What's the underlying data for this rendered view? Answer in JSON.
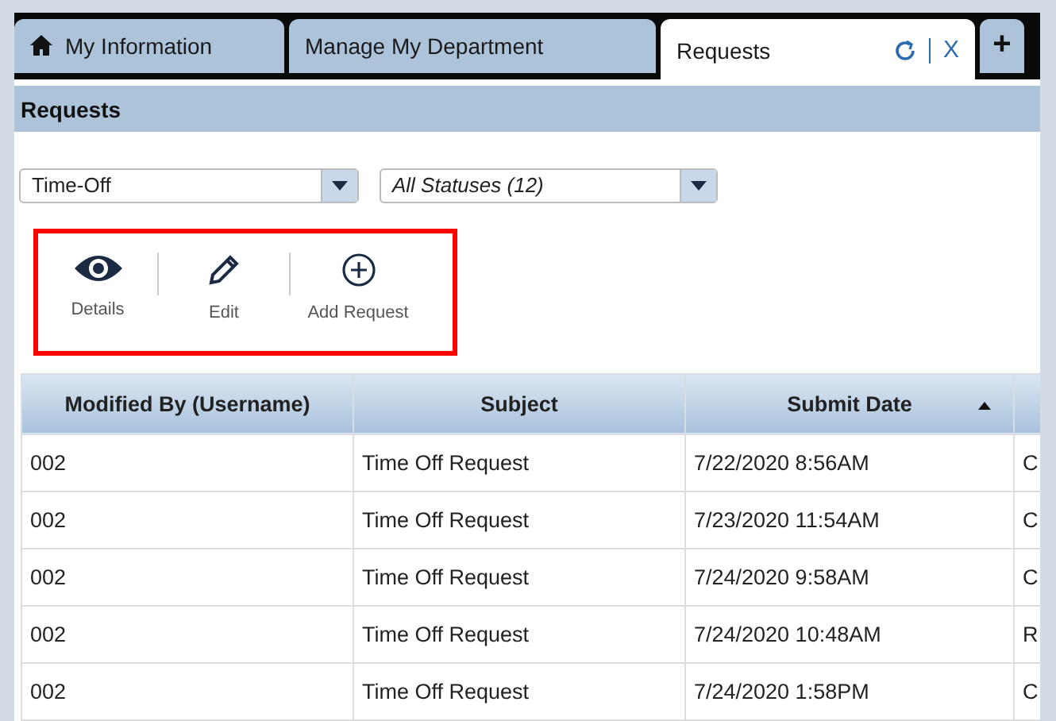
{
  "tabs": [
    {
      "label": "My Information",
      "kind": "home",
      "selected": false
    },
    {
      "label": "Manage My Department",
      "kind": "plain",
      "selected": false
    },
    {
      "label": "Requests",
      "kind": "closable",
      "selected": true,
      "close": "X"
    },
    {
      "label": "+",
      "kind": "add",
      "selected": false
    }
  ],
  "panel": {
    "title": "Requests"
  },
  "filters": [
    {
      "value": "Time-Off",
      "italic": false
    },
    {
      "value": "All Statuses (12)",
      "italic": true
    }
  ],
  "toolbar": [
    {
      "label": "Details",
      "kind": "eye"
    },
    {
      "label": "Edit",
      "kind": "pencil"
    },
    {
      "label": "Add Request",
      "kind": "plus"
    }
  ],
  "table": {
    "columns": [
      {
        "label": "Modified By (Username)",
        "sorted": false
      },
      {
        "label": "Subject",
        "sorted": false
      },
      {
        "label": "Submit Date",
        "sorted": true
      },
      {}
    ],
    "rows": [
      [
        "002",
        "Time Off Request",
        "7/22/2020 8:56AM",
        "C"
      ],
      [
        "002",
        "Time Off Request",
        "7/23/2020 11:54AM",
        "C"
      ],
      [
        "002",
        "Time Off Request",
        "7/24/2020 9:58AM",
        "C"
      ],
      [
        "002",
        "Time Off Request",
        "7/24/2020 10:48AM",
        "R"
      ],
      [
        "002",
        "Time Off Request",
        "7/24/2020 1:58PM",
        "C"
      ]
    ]
  }
}
